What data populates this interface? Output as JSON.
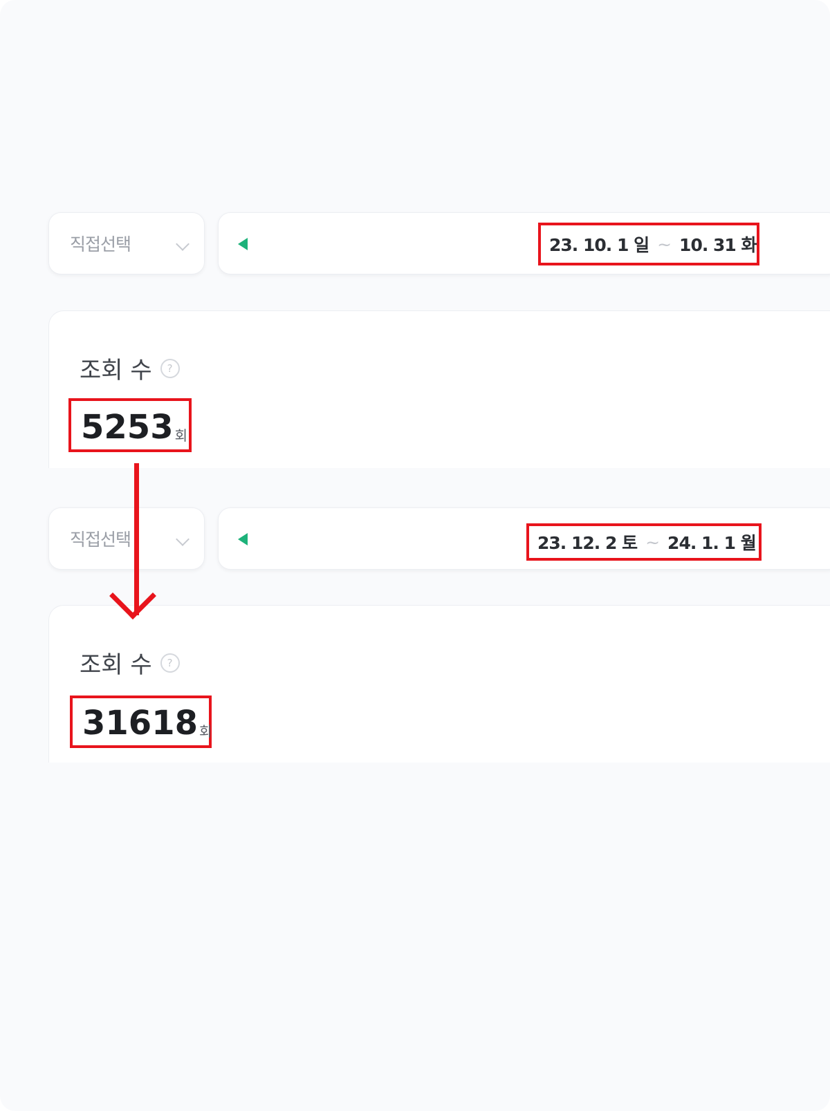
{
  "panels": [
    {
      "period_select": {
        "label": "직접선택"
      },
      "date_range": {
        "start": "23. 10. 1 일",
        "separator": "~",
        "end": "10. 31 화"
      },
      "stat": {
        "title": "조회 수",
        "help": "?",
        "value": "5253",
        "unit": "회"
      }
    },
    {
      "period_select": {
        "label": "직접선택"
      },
      "date_range": {
        "start": "23. 12. 2 토",
        "separator": "~",
        "end": "24. 1. 1 월"
      },
      "stat": {
        "title": "조회 수",
        "help": "?",
        "value": "31618",
        "unit": "회"
      }
    }
  ],
  "colors": {
    "highlight": "#e8141c",
    "accent_green": "#1db27a",
    "background": "#f9fafc"
  },
  "icons": [
    "chevron-down-icon",
    "prev-arrow-icon",
    "help-icon",
    "down-arrow-icon"
  ]
}
